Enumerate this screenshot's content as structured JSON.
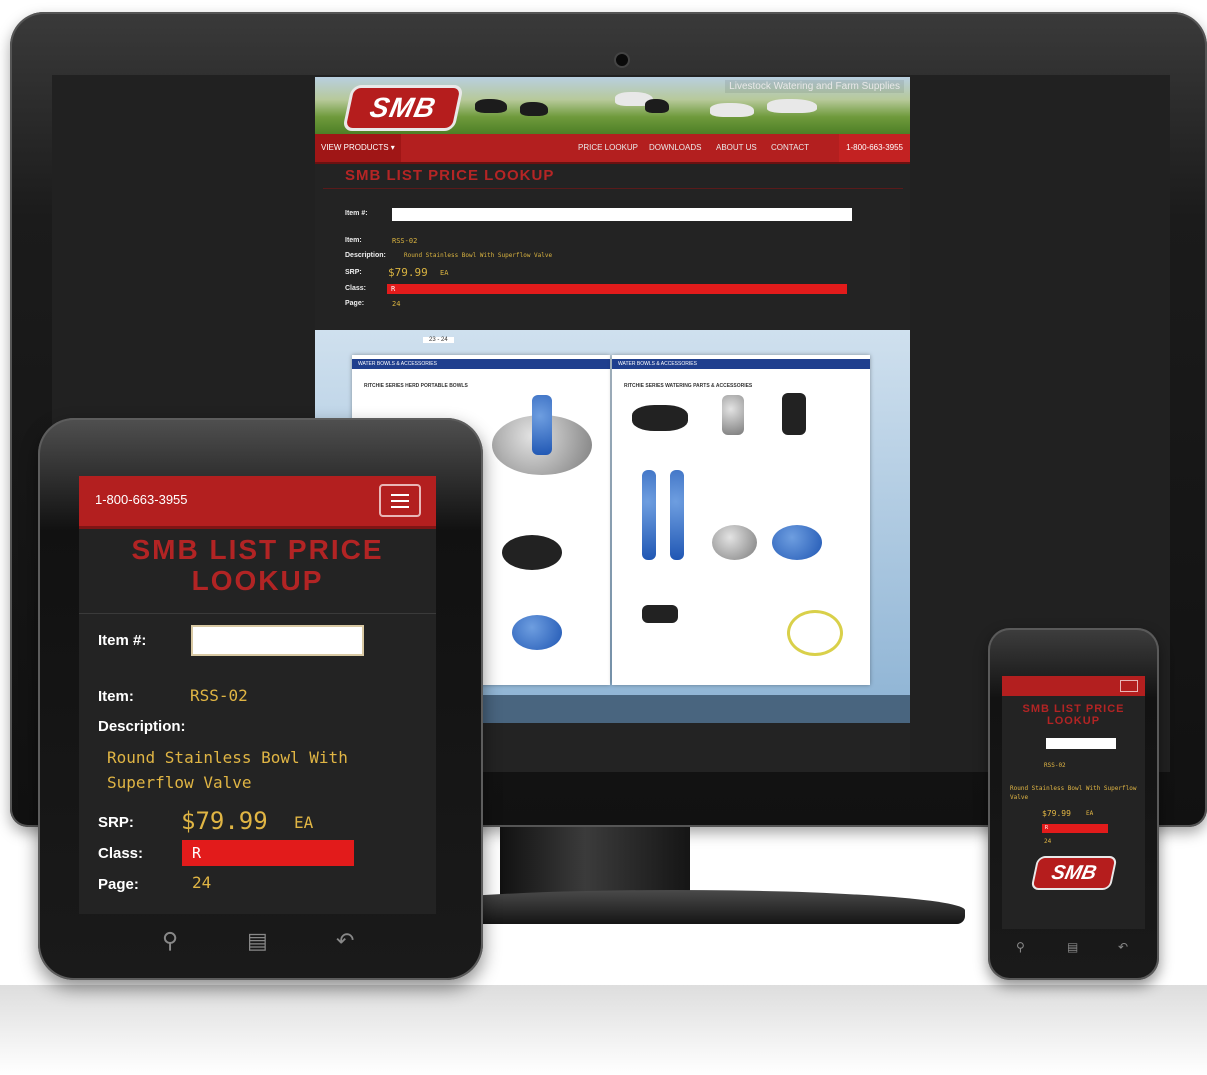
{
  "desktop": {
    "tagline": "Livestock Watering and Farm Supplies",
    "logo_text": "SMB",
    "nav": {
      "products": "VIEW PRODUCTS ▾",
      "links": [
        "PRICE LOOKUP",
        "DOWNLOADS",
        "ABOUT US",
        "CONTACT"
      ],
      "phone": "1-800-663-3955"
    },
    "title": "SMB LIST PRICE LOOKUP",
    "labels": {
      "item_no": "Item #:",
      "item": "Item:",
      "description": "Description:",
      "srp": "SRP:",
      "class": "Class:",
      "page": "Page:"
    },
    "values": {
      "item": "RSS-02",
      "description": "Round Stainless Bowl With Superflow Valve",
      "srp": "$79.99",
      "unit": "EA",
      "class": "R",
      "page": "24"
    },
    "catalog": {
      "toolbar_pages": "23 - 24",
      "left_header": "WATER BOWLS & ACCESSORIES",
      "right_header": "WATER BOWLS & ACCESSORIES",
      "left_subtitle": "RITCHIE SERIES HERD PORTABLE BOWLS",
      "right_subtitle": "RITCHIE SERIES WATERING PARTS & ACCESSORIES"
    }
  },
  "tablet": {
    "phone": "1-800-663-3955",
    "title": "SMB LIST PRICE LOOKUP",
    "labels": {
      "item_no": "Item #:",
      "item": "Item:",
      "description": "Description:",
      "srp": "SRP:",
      "class": "Class:",
      "page": "Page:"
    },
    "values": {
      "item": "RSS-02",
      "description_line1": "Round Stainless Bowl With",
      "description_line2": "Superflow Valve",
      "srp": "$79.99",
      "unit": "EA",
      "class": "R",
      "page": "24"
    }
  },
  "phone": {
    "title": "SMB LIST PRICE LOOKUP",
    "logo_text": "SMB",
    "values": {
      "item": "RSS-02",
      "description": "Round Stainless Bowl With Superflow Valve",
      "srp": "$79.99",
      "unit": "EA",
      "class": "R",
      "page": "24"
    }
  },
  "colors": {
    "brand_red": "#b31f1f",
    "class_red": "#e21b1b",
    "value_gold": "#e0b544",
    "background": "#232323"
  },
  "icons": [
    "search-icon",
    "home-icon",
    "back-icon",
    "menu-icon"
  ]
}
